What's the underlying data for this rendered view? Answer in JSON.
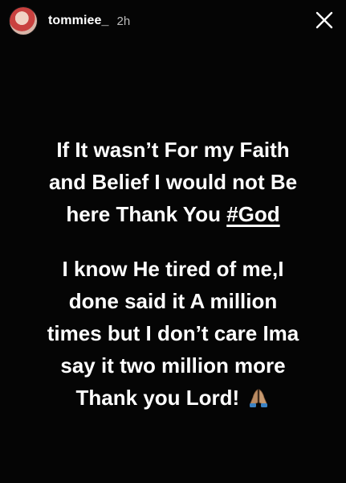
{
  "story": {
    "username": "tommiee_",
    "time_ago": "2h",
    "avatar_icon": "profile-avatar",
    "close_icon": "close-x-icon"
  },
  "text": {
    "paragraph1_lines": [
      "If It wasn’t For my Faith",
      "and Belief I would not Be",
      "here Thank You"
    ],
    "hashtag": "#God",
    "paragraph2_lines": [
      "I know He tired of me,I",
      "done said it A million",
      "times but I don’t care Ima",
      "say it two million more",
      "Thank you Lord!"
    ],
    "emoji_icon": "praying-hands-icon"
  },
  "colors": {
    "background": "#050505",
    "text": "#ffffff",
    "muted": "#bdbdbd"
  }
}
